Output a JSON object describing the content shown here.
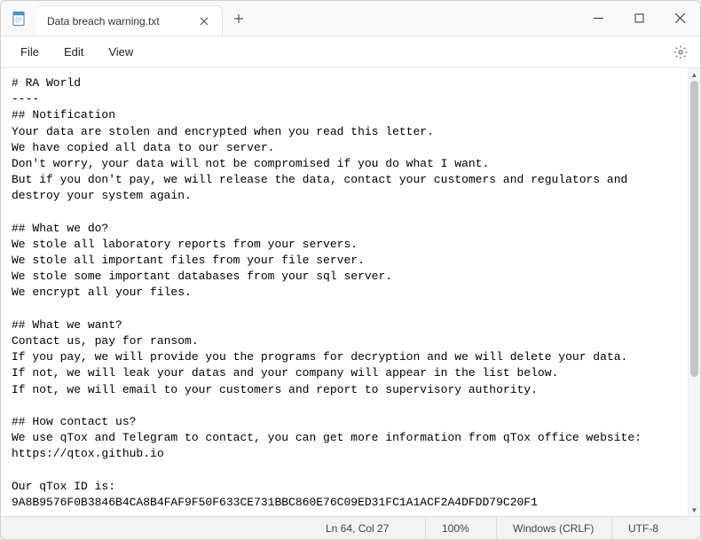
{
  "window": {
    "tab_title": "Data breach warning.txt"
  },
  "menubar": {
    "file": "File",
    "edit": "Edit",
    "view": "View"
  },
  "document": {
    "content": "# RA World\n----\n## Notification\nYour data are stolen and encrypted when you read this letter.\nWe have copied all data to our server.\nDon't worry, your data will not be compromised if you do what I want.\nBut if you don't pay, we will release the data, contact your customers and regulators and destroy your system again.\n\n## What we do?\nWe stole all laboratory reports from your servers.\nWe stole all important files from your file server.\nWe stole some important databases from your sql server.\nWe encrypt all your files.\n\n## What we want?\nContact us, pay for ransom.\nIf you pay, we will provide you the programs for decryption and we will delete your data.\nIf not, we will leak your datas and your company will appear in the list below.\nIf not, we will email to your customers and report to supervisory authority.\n\n## How contact us?\nWe use qTox and Telegram to contact, you can get more information from qTox office website: https://qtox.github.io\n\nOur qTox ID is:\n9A8B9576F0B3846B4CA8B4FAF9F50F633CE731BBC860E76C09ED31FC1A1ACF2A4DFDD79C20F1"
  },
  "statusbar": {
    "position": "Ln 64, Col 27",
    "zoom": "100%",
    "line_ending": "Windows (CRLF)",
    "encoding": "UTF-8"
  }
}
